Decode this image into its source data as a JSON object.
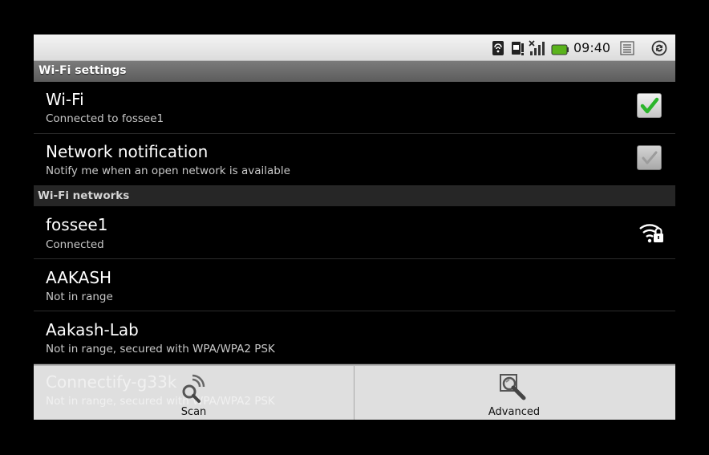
{
  "status_bar": {
    "time": "09:40",
    "icons": [
      "sd-card-icon",
      "sim-icon",
      "signal-icon",
      "battery-icon",
      "notification-list-icon",
      "sync-icon"
    ]
  },
  "header": {
    "title": "Wi-Fi settings"
  },
  "settings": [
    {
      "title": "Wi-Fi",
      "summary": "Connected to fossee1",
      "checked": true,
      "enabled": true
    },
    {
      "title": "Network notification",
      "summary": "Notify me when an open network is available",
      "checked": true,
      "enabled": false
    }
  ],
  "networks_section": {
    "title": "Wi-Fi networks"
  },
  "networks": [
    {
      "ssid": "fossee1",
      "status": "Connected",
      "icon": "wifi-lock-icon"
    },
    {
      "ssid": "AAKASH",
      "status": "Not in range"
    },
    {
      "ssid": "Aakash-Lab",
      "status": "Not in range, secured with WPA/WPA2 PSK"
    },
    {
      "ssid": "Connectify-g33k",
      "status": "Not in range, secured with WPA/WPA2 PSK"
    }
  ],
  "actions": {
    "scan_label": "Scan",
    "advanced_label": "Advanced"
  },
  "colors": {
    "check_green": "#2bb52b",
    "status_bar": "#e8e8e8",
    "section": "#262626"
  }
}
